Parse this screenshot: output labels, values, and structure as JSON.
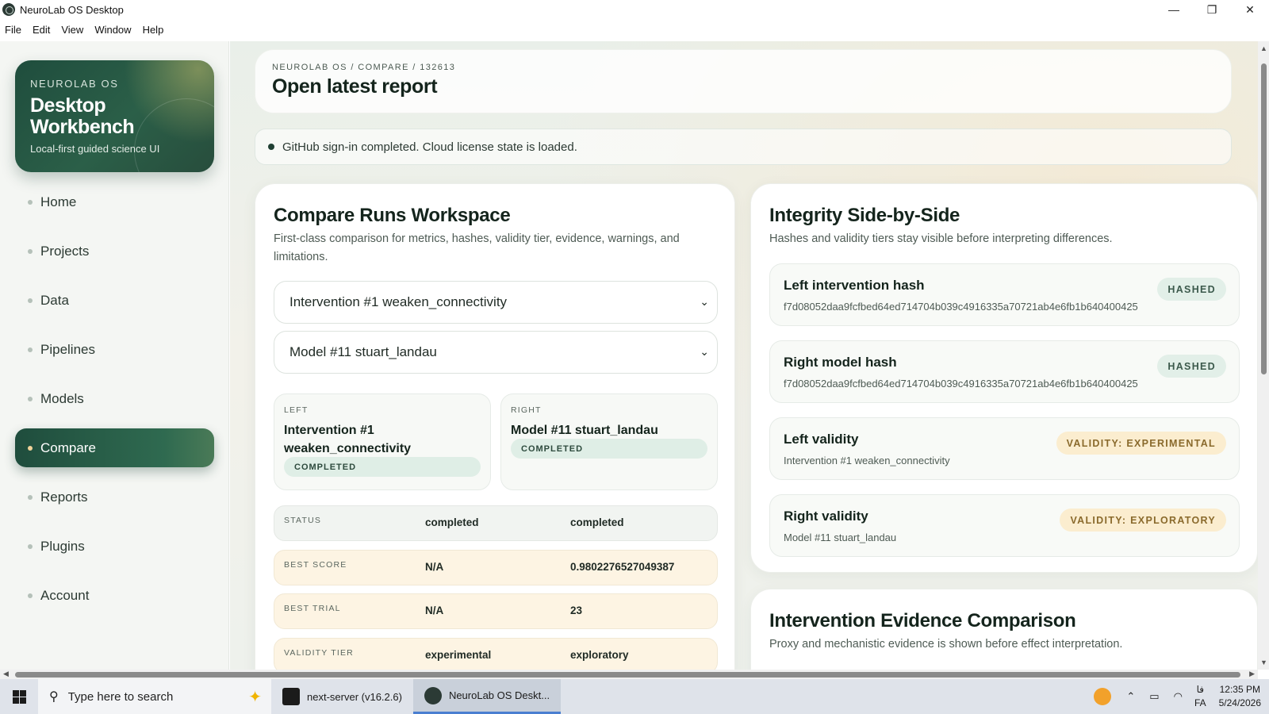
{
  "window": {
    "title": "NeuroLab OS Desktop",
    "controls": {
      "minimize": "—",
      "maximize": "❐",
      "close": "✕"
    }
  },
  "menubar": [
    "File",
    "Edit",
    "View",
    "Window",
    "Help"
  ],
  "sidebar": {
    "brand": {
      "kicker": "NEUROLAB OS",
      "title": "Desktop Workbench",
      "subtitle": "Local-first guided science UI"
    },
    "nav": [
      {
        "label": "Home",
        "active": false
      },
      {
        "label": "Projects",
        "active": false
      },
      {
        "label": "Data",
        "active": false
      },
      {
        "label": "Pipelines",
        "active": false
      },
      {
        "label": "Models",
        "active": false
      },
      {
        "label": "Compare",
        "active": true
      },
      {
        "label": "Reports",
        "active": false
      },
      {
        "label": "Plugins",
        "active": false
      },
      {
        "label": "Account",
        "active": false
      }
    ]
  },
  "header": {
    "breadcrumb": "NEUROLAB OS / COMPARE / 132613",
    "title": "Open latest report"
  },
  "status": {
    "message": "GitHub sign-in completed. Cloud license state is loaded."
  },
  "compare": {
    "title": "Compare Runs Workspace",
    "description": "First-class comparison for metrics, hashes, validity tier, evidence, warnings, and limitations.",
    "left_select": "Intervention #1 weaken_connectivity",
    "right_select": "Model #11 stuart_landau",
    "left_card": {
      "kicker": "LEFT",
      "name": "Intervention #1 weaken_connectivity",
      "status": "COMPLETED"
    },
    "right_card": {
      "kicker": "RIGHT",
      "name": "Model #11 stuart_landau",
      "status": "COMPLETED"
    },
    "rows": [
      {
        "label": "STATUS",
        "left": "completed",
        "right": "completed",
        "tone": "gray"
      },
      {
        "label": "BEST SCORE",
        "left": "N/A",
        "right": "0.9802276527049387",
        "tone": "cream"
      },
      {
        "label": "BEST TRIAL",
        "left": "N/A",
        "right": "23",
        "tone": "cream"
      },
      {
        "label": "VALIDITY TIER",
        "left": "experimental",
        "right": "exploratory",
        "tone": "cream"
      }
    ]
  },
  "integrity": {
    "title": "Integrity Side-by-Side",
    "description": "Hashes and validity tiers stay visible before interpreting differences.",
    "cards": [
      {
        "title": "Left intervention hash",
        "sub": "f7d08052daa9fcfbed64ed714704b039c4916335a70721ab4e6fb1b640400425",
        "badge": "HASHED",
        "tone": "green"
      },
      {
        "title": "Right model hash",
        "sub": "f7d08052daa9fcfbed64ed714704b039c4916335a70721ab4e6fb1b640400425",
        "badge": "HASHED",
        "tone": "green"
      },
      {
        "title": "Left validity",
        "sub": "Intervention #1 weaken_connectivity",
        "badge": "VALIDITY: EXPERIMENTAL",
        "tone": "amber"
      },
      {
        "title": "Right validity",
        "sub": "Model #11 stuart_landau",
        "badge": "VALIDITY: EXPLORATORY",
        "tone": "amber"
      }
    ]
  },
  "evidence": {
    "title": "Intervention Evidence Comparison",
    "description": "Proxy and mechanistic evidence is shown before effect interpretation."
  },
  "taskbar": {
    "search_placeholder": "Type here to search",
    "apps": [
      {
        "label": "next-server (v16.2.6)",
        "active": false
      },
      {
        "label": "NeuroLab OS Deskt...",
        "active": true
      }
    ],
    "tray": {
      "lang_top": "فا",
      "lang_bottom": "FA",
      "time": "12:35 PM",
      "date": "5/24/2026"
    }
  },
  "colors": {
    "accent": "#1f4d3d",
    "cream_row": "#fdf4e3",
    "badge_green": "#e2efe8",
    "badge_amber": "#fbedcf"
  }
}
